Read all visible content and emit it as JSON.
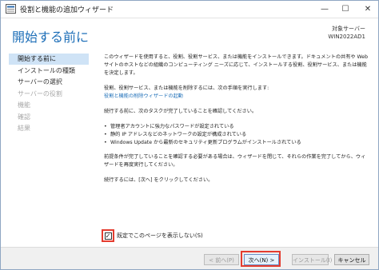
{
  "window": {
    "title": "役割と機能の追加ウィザード",
    "minimize_glyph": "—",
    "maximize_glyph": "☐",
    "close_glyph": "✕"
  },
  "header": {
    "title": "開始する前に",
    "target_label": "対象サーバー",
    "target_server": "WIN2022AD1"
  },
  "nav": {
    "items": [
      {
        "label": "開始する前に",
        "state": "active"
      },
      {
        "label": "インストールの種類",
        "state": "enabled"
      },
      {
        "label": "サーバーの選択",
        "state": "enabled"
      },
      {
        "label": "サーバーの役割",
        "state": "disabled"
      },
      {
        "label": "機能",
        "state": "disabled"
      },
      {
        "label": "確認",
        "state": "disabled"
      },
      {
        "label": "結果",
        "state": "disabled"
      }
    ]
  },
  "content": {
    "intro": "このウィザードを使用すると、役割、役割サービス、または機能をインストールできます。ドキュメントの共有や Web サイトのホストなどの組織のコンピューティング ニーズに応じて、インストールする役割、役割サービス、または機能を決定します。",
    "remove_text": "役割、役割サービス、または機能を削除するには、次の手順を実行します:",
    "remove_link": "役割と機能の削除ウィザードの起動",
    "before_text": "続行する前に、次のタスクが完了していることを確認してください。",
    "tasks": [
      "管理者アカウントに強力なパスワードが設定されている",
      "静的 IP アドレスなどのネットワークの設定が構成されている",
      "Windows Update から最新のセキュリティ更新プログラムがインストールされている"
    ],
    "prereq_text": "前提条件が完了していることを確認する必要がある場合は、ウィザードを閉じて、それらの作業を完了してから、ウィザードを再度実行してください。",
    "continue_text": "続行するには、[次へ] をクリックしてください。"
  },
  "options": {
    "skip_page_checked": true,
    "skip_page_label": "既定でこのページを表示しない(S)",
    "check_glyph": "✓"
  },
  "buttons": {
    "prev": "< 前へ(P)",
    "next": "次へ(N) >",
    "install": "インストール(I)",
    "cancel": "キャンセル"
  },
  "colors": {
    "accent": "#1e6fb8",
    "highlight_box": "#e43c2f",
    "nav_active_bg": "#cfe3f6"
  }
}
